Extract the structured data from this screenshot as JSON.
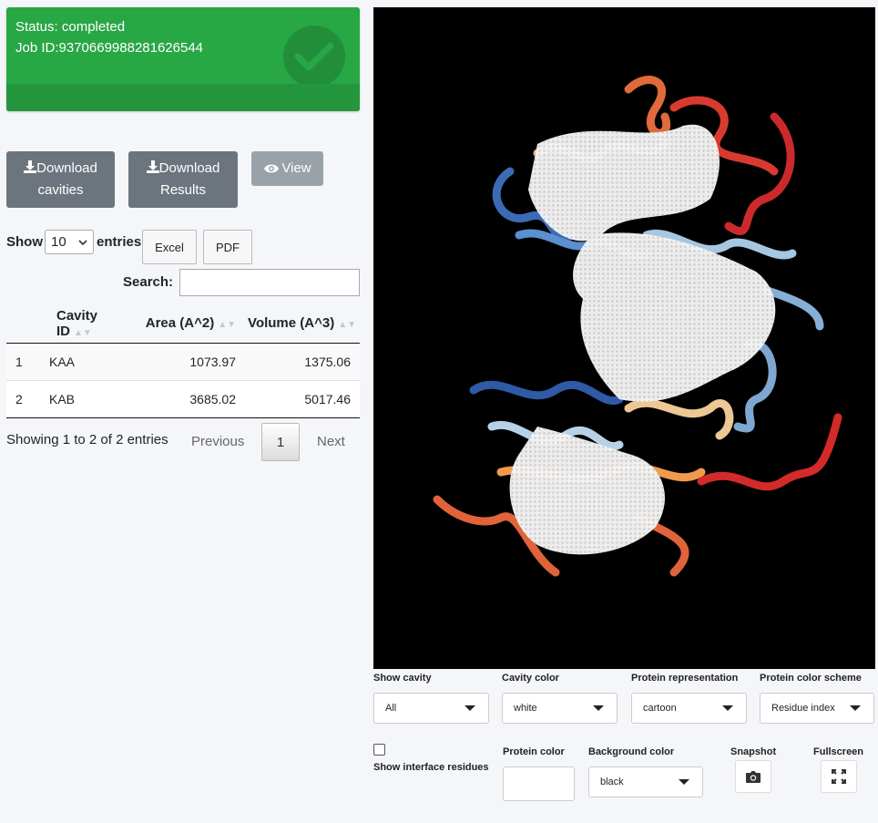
{
  "status": {
    "status_line": "Status: completed",
    "job_line": "Job ID:9370669988281626544",
    "icon": "check-circle-icon"
  },
  "actions": {
    "download_cavities": [
      "Download",
      "cavities"
    ],
    "download_results": [
      "Download",
      "Results"
    ],
    "view": "View"
  },
  "table_controls": {
    "show_label": "Show",
    "entries_value": "10",
    "entries_label": "entries",
    "excel": "Excel",
    "pdf": "PDF",
    "search_label": "Search:",
    "search_value": ""
  },
  "table": {
    "columns": [
      "",
      "Cavity ID",
      "Area (A^2)",
      "Volume (A^3)"
    ],
    "rows": [
      [
        "1",
        "KAA",
        "1073.97",
        "1375.06"
      ],
      [
        "2",
        "KAB",
        "3685.02",
        "5017.46"
      ]
    ]
  },
  "pagination": {
    "info": "Showing 1 to 2 of 2 entries",
    "previous": "Previous",
    "current": "1",
    "next": "Next"
  },
  "viewer_controls": {
    "show_cavity_label": "Show cavity",
    "show_cavity_value": "All",
    "cavity_color_label": "Cavity color",
    "cavity_color_value": "white",
    "protein_repr_label": "Protein representation",
    "protein_repr_value": "cartoon",
    "protein_scheme_label": "Protein color scheme",
    "protein_scheme_value": "Residue index",
    "interface_label": "Show interface residues",
    "protein_color_label": "Protein color",
    "background_color_label": "Background color",
    "background_color_value": "black",
    "snapshot_label": "Snapshot",
    "fullscreen_label": "Fullscreen"
  },
  "colors": {
    "status_green": "#28a745",
    "button_gray": "#6c757d",
    "viewer_bg": "#000000"
  }
}
